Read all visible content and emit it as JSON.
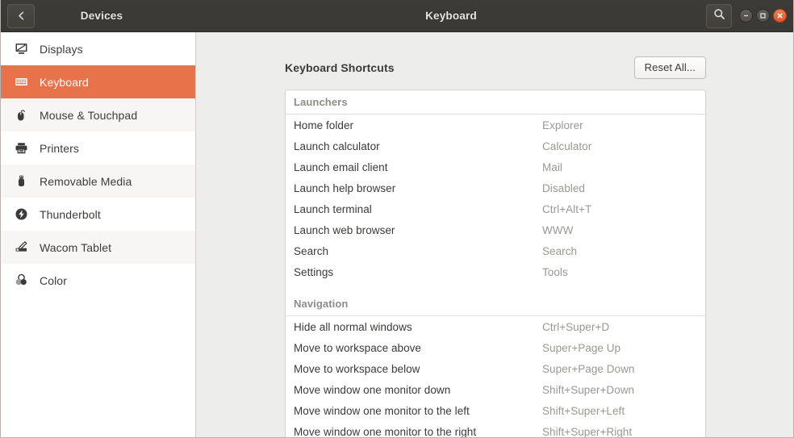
{
  "titlebar": {
    "back_icon": "chevron-left-icon",
    "sidebar_title": "Devices",
    "window_title": "Keyboard",
    "search_icon": "search-icon",
    "minimize_label": "—",
    "maximize_label": "□",
    "close_label": "×"
  },
  "sidebar": {
    "items": [
      {
        "label": "Displays",
        "icon": "display-icon",
        "selected": false
      },
      {
        "label": "Keyboard",
        "icon": "keyboard-icon",
        "selected": true
      },
      {
        "label": "Mouse & Touchpad",
        "icon": "mouse-icon",
        "selected": false
      },
      {
        "label": "Printers",
        "icon": "printer-icon",
        "selected": false
      },
      {
        "label": "Removable Media",
        "icon": "usb-drive-icon",
        "selected": false
      },
      {
        "label": "Thunderbolt",
        "icon": "thunderbolt-icon",
        "selected": false
      },
      {
        "label": "Wacom Tablet",
        "icon": "wacom-tablet-icon",
        "selected": false
      },
      {
        "label": "Color",
        "icon": "color-wheel-icon",
        "selected": false
      }
    ]
  },
  "main": {
    "heading": "Keyboard Shortcuts",
    "reset_all_label": "Reset All...",
    "sections": [
      {
        "title": "Launchers",
        "rows": [
          {
            "name": "Home folder",
            "value": "Explorer"
          },
          {
            "name": "Launch calculator",
            "value": "Calculator"
          },
          {
            "name": "Launch email client",
            "value": "Mail"
          },
          {
            "name": "Launch help browser",
            "value": "Disabled"
          },
          {
            "name": "Launch terminal",
            "value": "Ctrl+Alt+T"
          },
          {
            "name": "Launch web browser",
            "value": "WWW"
          },
          {
            "name": "Search",
            "value": "Search"
          },
          {
            "name": "Settings",
            "value": "Tools"
          }
        ]
      },
      {
        "title": "Navigation",
        "rows": [
          {
            "name": "Hide all normal windows",
            "value": "Ctrl+Super+D"
          },
          {
            "name": "Move to workspace above",
            "value": "Super+Page Up"
          },
          {
            "name": "Move to workspace below",
            "value": "Super+Page Down"
          },
          {
            "name": "Move window one monitor down",
            "value": "Shift+Super+Down"
          },
          {
            "name": "Move window one monitor to the left",
            "value": "Shift+Super+Left"
          },
          {
            "name": "Move window one monitor to the right",
            "value": "Shift+Super+Right"
          }
        ]
      }
    ]
  },
  "colors": {
    "accent": "#e8734a",
    "close_button": "#e2512a",
    "titlebar": "#3a3935",
    "content_bg": "#ededeb",
    "value_text": "#9a9893"
  }
}
